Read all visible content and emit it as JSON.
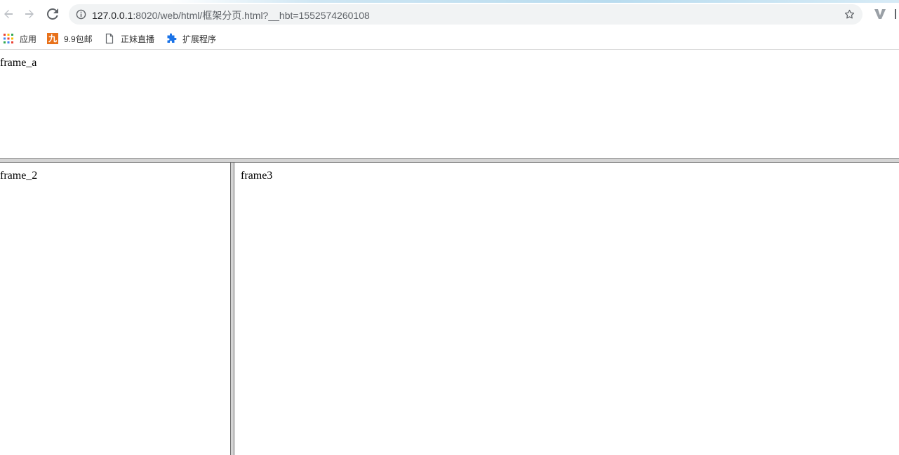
{
  "browser": {
    "address": {
      "host": "127.0.0.1",
      "path": ":8020/web/html/框架分页.html?__hbt=1552574260108"
    },
    "icons": {
      "back": "back-arrow-icon",
      "forward": "forward-arrow-icon",
      "reload": "reload-icon",
      "info": "info-icon",
      "star": "bookmark-star-icon",
      "extension": "extension-v-icon"
    }
  },
  "bookmarks": [
    {
      "label": "应用",
      "icon": "apps-grid-icon"
    },
    {
      "label": "9.9包邮",
      "icon": "jiu-logo-icon"
    },
    {
      "label": "正妹直播",
      "icon": "page-icon"
    },
    {
      "label": "扩展程序",
      "icon": "puzzle-icon"
    }
  ],
  "frames": {
    "top": "frame_a",
    "left": "frame_2",
    "right": "frame3"
  },
  "colors": {
    "frame_border": "#6b6b6b",
    "frame_separator": "#d4d4d4",
    "jiu_logo": "#e8711a",
    "puzzle": "#1a73e8"
  }
}
